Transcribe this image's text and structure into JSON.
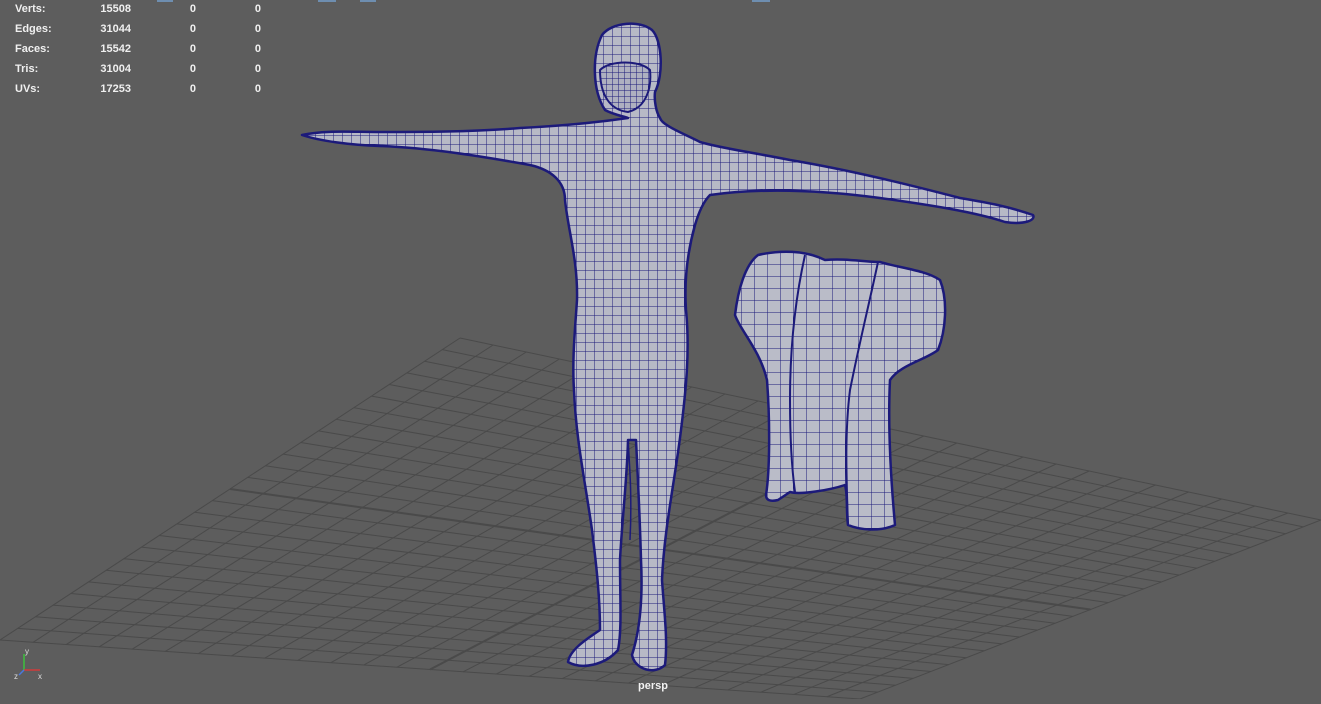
{
  "heads_up": {
    "rows": [
      {
        "label": "Verts:",
        "value": "15508",
        "c1": "0",
        "c2": "0"
      },
      {
        "label": "Edges:",
        "value": "31044",
        "c1": "0",
        "c2": "0"
      },
      {
        "label": "Faces:",
        "value": "15542",
        "c1": "0",
        "c2": "0"
      },
      {
        "label": "Tris:",
        "value": "31004",
        "c1": "0",
        "c2": "0"
      },
      {
        "label": "UVs:",
        "value": "17253",
        "c1": "0",
        "c2": "0"
      }
    ]
  },
  "camera": {
    "name": "persp"
  },
  "axis": {
    "y": "y",
    "z": "z",
    "x": "x"
  },
  "colors": {
    "background": "#5d5d5d",
    "grid": "#4a4a4a",
    "mesh_fill": "#b7b9c6",
    "wireframe": "#1c1a7a"
  }
}
